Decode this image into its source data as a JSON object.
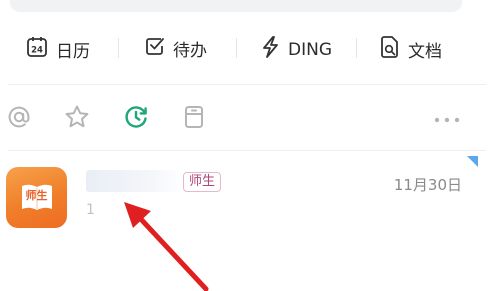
{
  "quick_actions": [
    {
      "label": "日历",
      "icon": "calendar-icon",
      "badge": "24"
    },
    {
      "label": "待办",
      "icon": "todo-checkbox-icon"
    },
    {
      "label": "DING",
      "icon": "ding-lightning-icon"
    },
    {
      "label": "文档",
      "icon": "document-icon"
    }
  ],
  "filters": [
    {
      "icon": "at-mention-icon",
      "active": false
    },
    {
      "icon": "star-icon",
      "active": false
    },
    {
      "icon": "recent-clock-icon",
      "active": true
    },
    {
      "icon": "archive-box-icon",
      "active": false
    },
    {
      "icon": "more-dots-icon",
      "active": false
    }
  ],
  "conversation": {
    "avatar_text": "师生",
    "tag": "师生",
    "date": "11月30日",
    "preview_char": "1"
  },
  "colors": {
    "accent_green": "#1fa67a",
    "avatar_orange": "#f07e2a",
    "tag_text": "#b0467a",
    "tag_border": "#e5b9cc",
    "unread_flag": "#5aa7ef",
    "annotation_arrow": "#e02020"
  }
}
